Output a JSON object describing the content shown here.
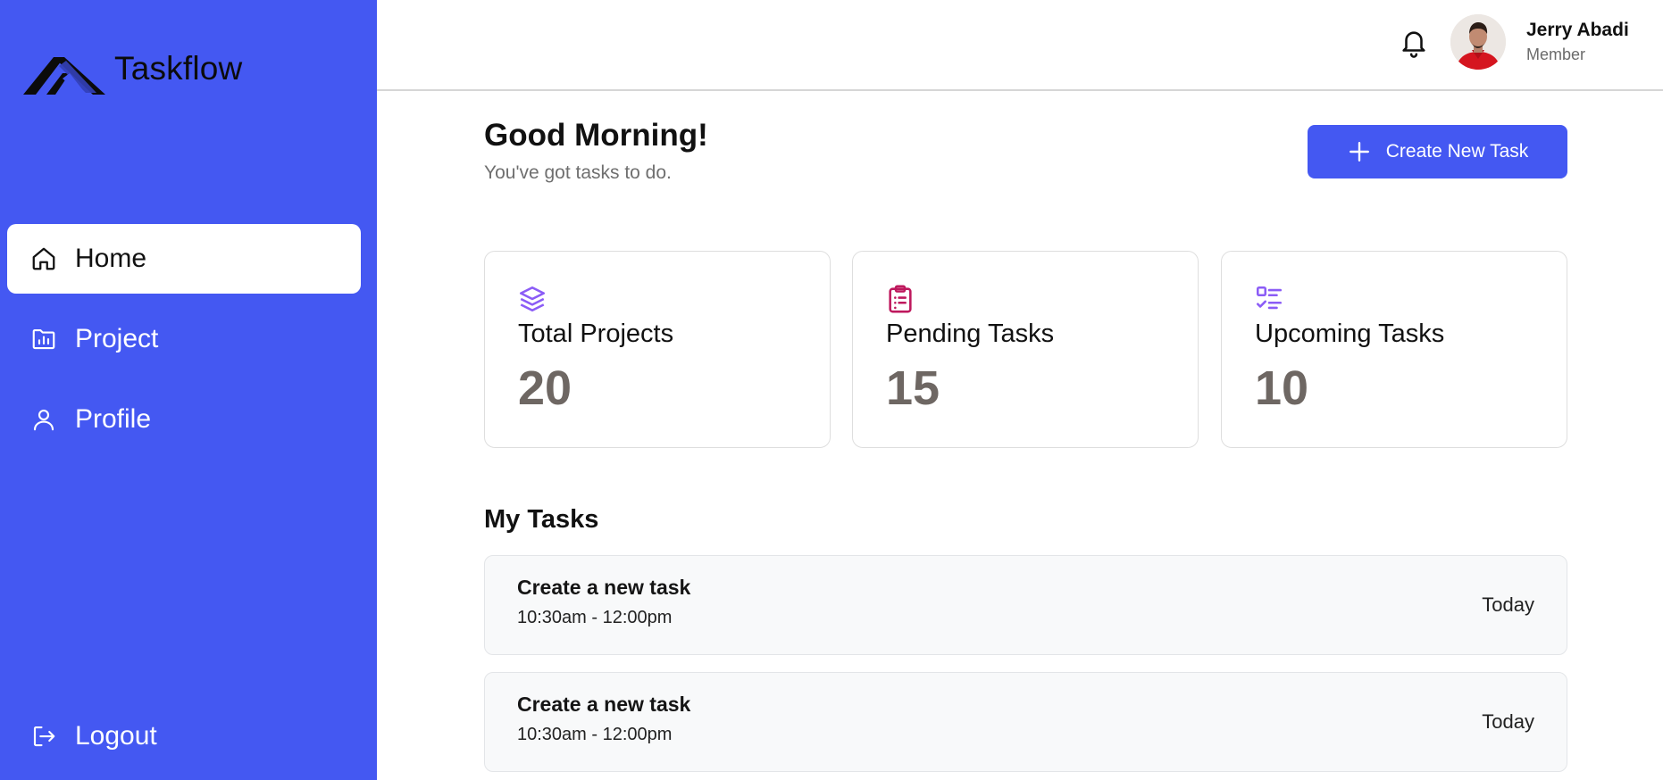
{
  "app": {
    "name": "Taskflow"
  },
  "sidebar": {
    "items": [
      {
        "label": "Home",
        "icon": "home-icon",
        "active": true
      },
      {
        "label": "Project",
        "icon": "folder-chart-icon",
        "active": false
      },
      {
        "label": "Profile",
        "icon": "user-icon",
        "active": false
      }
    ],
    "logout_label": "Logout"
  },
  "header": {
    "user_name": "Jerry Abadi",
    "user_role": "Member"
  },
  "main": {
    "greeting": "Good Morning!",
    "subtitle": "You've got tasks to do.",
    "create_button": "Create New Task",
    "stats": [
      {
        "label": "Total Projects",
        "value": "20",
        "icon": "layers-icon",
        "color": "#8b5cf6"
      },
      {
        "label": "Pending Tasks",
        "value": "15",
        "icon": "clipboard-icon",
        "color": "#be185d"
      },
      {
        "label": "Upcoming Tasks",
        "value": "10",
        "icon": "checklist-icon",
        "color": "#8b5cf6"
      }
    ],
    "my_tasks_title": "My Tasks",
    "tasks": [
      {
        "title": "Create a new task",
        "time": "10:30am - 12:00pm",
        "when": "Today"
      },
      {
        "title": "Create a new task",
        "time": "10:30am - 12:00pm",
        "when": "Today"
      }
    ]
  },
  "colors": {
    "primary": "#4458f2",
    "stat_value": "#6e6763"
  }
}
